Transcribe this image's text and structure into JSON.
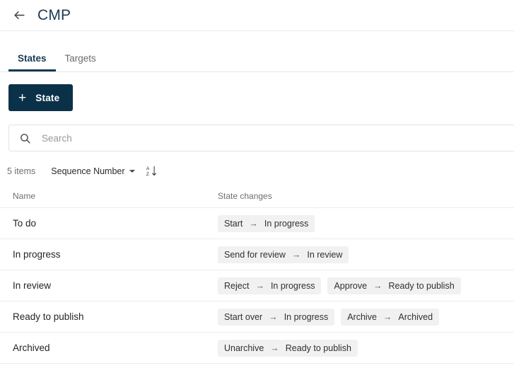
{
  "header": {
    "back_icon": "arrow-left-icon",
    "title": "CMP"
  },
  "tabs": [
    {
      "label": "States",
      "active": true
    },
    {
      "label": "Targets",
      "active": false
    }
  ],
  "toolbar": {
    "add_label": "State",
    "add_plus": "+"
  },
  "search": {
    "icon": "search-icon",
    "placeholder": "Search",
    "value": ""
  },
  "meta": {
    "item_count": "5 items",
    "sort_field": "Sequence Number",
    "sort_caret": "chevron-down-icon",
    "sort_direction_icon": "sort-az-descending-icon",
    "sort_direction_label": "A\nZ"
  },
  "table": {
    "columns": [
      "Name",
      "State changes"
    ],
    "rows": [
      {
        "name": "To do",
        "changes": [
          {
            "action": "Start",
            "arrow": "→",
            "target": "In progress"
          }
        ]
      },
      {
        "name": "In progress",
        "changes": [
          {
            "action": "Send for review",
            "arrow": "→",
            "target": "In review"
          }
        ]
      },
      {
        "name": "In review",
        "changes": [
          {
            "action": "Reject",
            "arrow": "→",
            "target": "In progress"
          },
          {
            "action": "Approve",
            "arrow": "→",
            "target": "Ready to publish"
          }
        ]
      },
      {
        "name": "Ready to publish",
        "changes": [
          {
            "action": "Start over",
            "arrow": "→",
            "target": "In progress"
          },
          {
            "action": "Archive",
            "arrow": "→",
            "target": "Archived"
          }
        ]
      },
      {
        "name": "Archived",
        "changes": [
          {
            "action": "Unarchive",
            "arrow": "→",
            "target": "Ready to publish"
          }
        ]
      }
    ]
  },
  "colors": {
    "brand_dark": "#0b3148",
    "title": "#1e3a52",
    "chip_bg": "#f1f1f1",
    "border": "#ececec"
  }
}
